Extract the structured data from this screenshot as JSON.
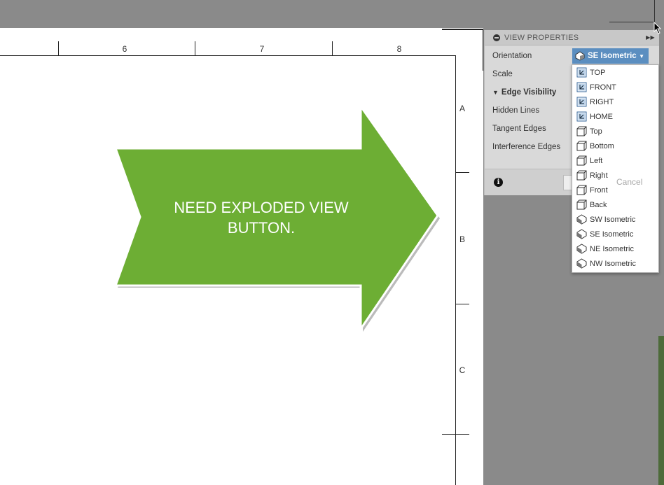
{
  "drawing": {
    "col_labels": [
      "6",
      "7",
      "8"
    ],
    "row_labels": [
      "A",
      "B",
      "C"
    ]
  },
  "callout": {
    "line1": "NEED EXPLODED VIEW",
    "line2": "BUTTON.",
    "color": "#6dae34"
  },
  "panel": {
    "title": "VIEW PROPERTIES",
    "orientation_label": "Orientation",
    "orientation_value": "SE Isometric",
    "scale_label": "Scale",
    "edge_visibility": "Edge Visibility",
    "hidden_lines": "Hidden Lines",
    "tangent_edges": "Tangent Edges",
    "interference_edges": "Interference Edges",
    "cancel": "Cancel",
    "accent": "#5b8ec0"
  },
  "menu": {
    "items": [
      {
        "label": "TOP",
        "icon": "named-view"
      },
      {
        "label": "FRONT",
        "icon": "named-view"
      },
      {
        "label": "RIGHT",
        "icon": "named-view"
      },
      {
        "label": "HOME",
        "icon": "named-view"
      },
      {
        "label": "Top",
        "icon": "cube"
      },
      {
        "label": "Bottom",
        "icon": "cube"
      },
      {
        "label": "Left",
        "icon": "cube"
      },
      {
        "label": "Right",
        "icon": "cube"
      },
      {
        "label": "Front",
        "icon": "cube"
      },
      {
        "label": "Back",
        "icon": "cube"
      },
      {
        "label": "SW Isometric",
        "icon": "iso"
      },
      {
        "label": "SE Isometric",
        "icon": "iso"
      },
      {
        "label": "NE Isometric",
        "icon": "iso"
      },
      {
        "label": "NW Isometric",
        "icon": "iso"
      }
    ]
  }
}
